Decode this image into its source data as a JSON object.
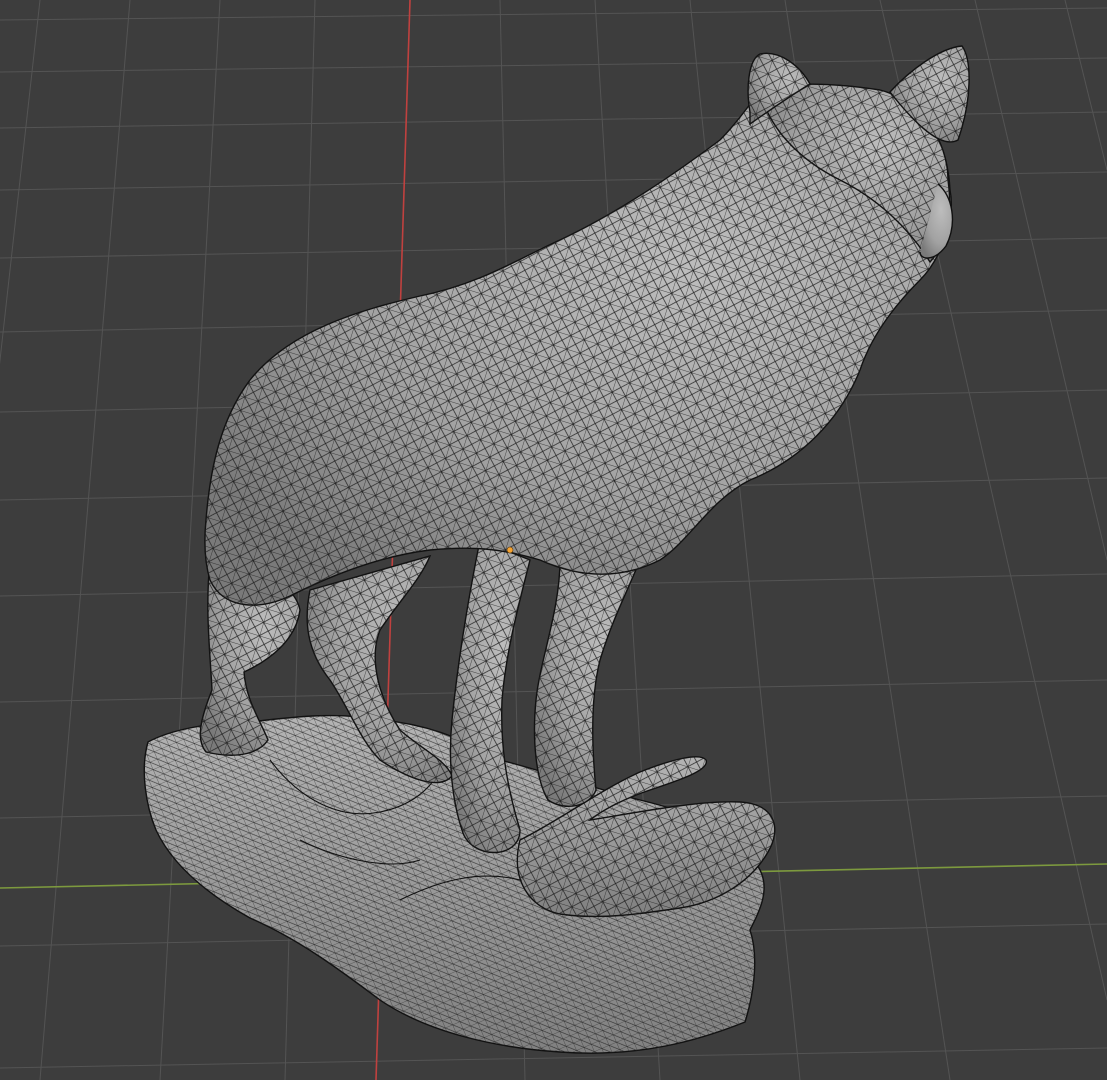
{
  "viewport": {
    "background_color": "#3d3d3d",
    "grid_color": "#545454",
    "x_axis_color": "#7d9a3e",
    "y_axis_color": "#c0413f",
    "mesh_fill_color": "#a9a9a9",
    "wire_color": "#1e1e1e",
    "origin_marker_color": "#f5a330"
  },
  "scene": {
    "object": "wolf-statue-mesh",
    "display_mode": "wireframe-overlay",
    "origin_marker_visible": true
  }
}
